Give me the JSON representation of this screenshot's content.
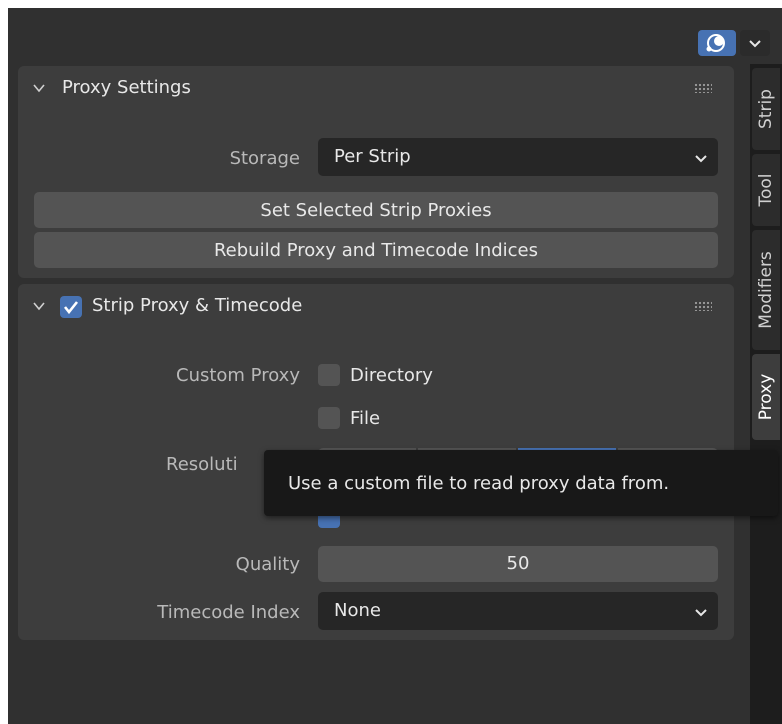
{
  "header": {
    "overlay_icon": "overlay-icon",
    "dropdown_icon": "chevron-down-icon"
  },
  "proxy_settings": {
    "title": "Proxy Settings",
    "storage_label": "Storage",
    "storage_value": "Per Strip",
    "set_selected_button": "Set Selected Strip Proxies",
    "rebuild_button": "Rebuild Proxy and Timecode Indices"
  },
  "strip_proxy": {
    "title": "Strip Proxy & Timecode",
    "enabled": true,
    "custom_proxy_label": "Custom Proxy",
    "directory_label": "Directory",
    "file_label": "File",
    "resolution_label": "Resoluti",
    "quality_label": "Quality",
    "quality_value": "50",
    "timecode_label": "Timecode Index",
    "timecode_value": "None"
  },
  "tooltip": "Use a custom file to read proxy data from.",
  "side_tabs": [
    {
      "label": "Strip",
      "active": false
    },
    {
      "label": "Tool",
      "active": false
    },
    {
      "label": "Modifiers",
      "active": false
    },
    {
      "label": "Proxy",
      "active": true
    }
  ],
  "colors": {
    "accent": "#4772b3",
    "panel": "#3d3d3d",
    "background": "#303030",
    "tooltip": "#181818"
  }
}
